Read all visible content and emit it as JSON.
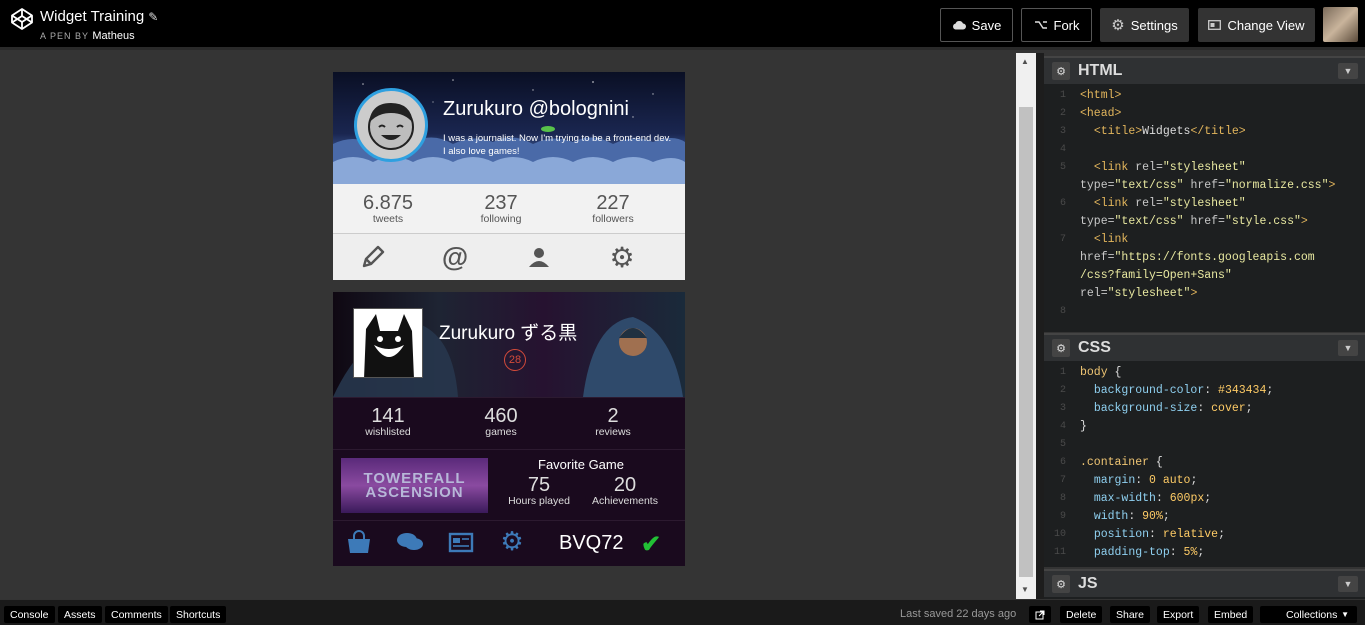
{
  "header": {
    "title": "Widget Training",
    "byline_prefix": "A PEN BY",
    "author": "Matheus",
    "buttons": {
      "save": "Save",
      "fork": "Fork",
      "settings": "Settings",
      "change_view": "Change View"
    }
  },
  "widget1": {
    "name": "Zurukuro @bolognini",
    "bio": "I was a journalist. Now I'm trying to be a front-end dev. I also love games!",
    "stats": [
      {
        "value": "6.875",
        "label": "tweets"
      },
      {
        "value": "237",
        "label": "following"
      },
      {
        "value": "227",
        "label": "followers"
      }
    ],
    "icons": [
      "pencil-icon",
      "at-icon",
      "user-icon",
      "gear-icon"
    ]
  },
  "widget2": {
    "name": "Zurukuro ずる黒",
    "level": "28",
    "stats": [
      {
        "value": "141",
        "label": "wishlisted"
      },
      {
        "value": "460",
        "label": "games"
      },
      {
        "value": "2",
        "label": "reviews"
      }
    ],
    "favorite": {
      "title": "Favorite Game",
      "image_text_1": "TOWERFALL",
      "image_text_2": "ASCENSION",
      "hours": {
        "value": "75",
        "label": "Hours played"
      },
      "achievements": {
        "value": "20",
        "label": "Achievements"
      }
    },
    "code": "BVQ72",
    "icons": [
      "shopping-bag-icon",
      "chat-icon",
      "news-icon",
      "gears-icon",
      "check-icon"
    ]
  },
  "panels": {
    "html": {
      "name": "HTML",
      "line_numbers": [
        "1",
        "2",
        "3",
        "4",
        "5",
        "",
        "6",
        "",
        "7",
        "",
        "",
        "",
        "8"
      ]
    },
    "css": {
      "name": "CSS",
      "line_numbers": [
        "1",
        "2",
        "3",
        "4",
        "5",
        "6",
        "7",
        "8",
        "9",
        "10",
        "11"
      ]
    },
    "js": {
      "name": "JS"
    }
  },
  "footer": {
    "buttons_left": [
      "Console",
      "Assets",
      "Comments",
      "Shortcuts"
    ],
    "saved": "Last saved 22 days ago",
    "buttons_right": [
      "Delete",
      "Share",
      "Export",
      "Embed",
      "Collections"
    ]
  },
  "colors": {
    "accent_blue": "#2ea0e0",
    "level_red": "#d24a3a",
    "check_green": "#22c035",
    "preview_bg": "#343434"
  }
}
